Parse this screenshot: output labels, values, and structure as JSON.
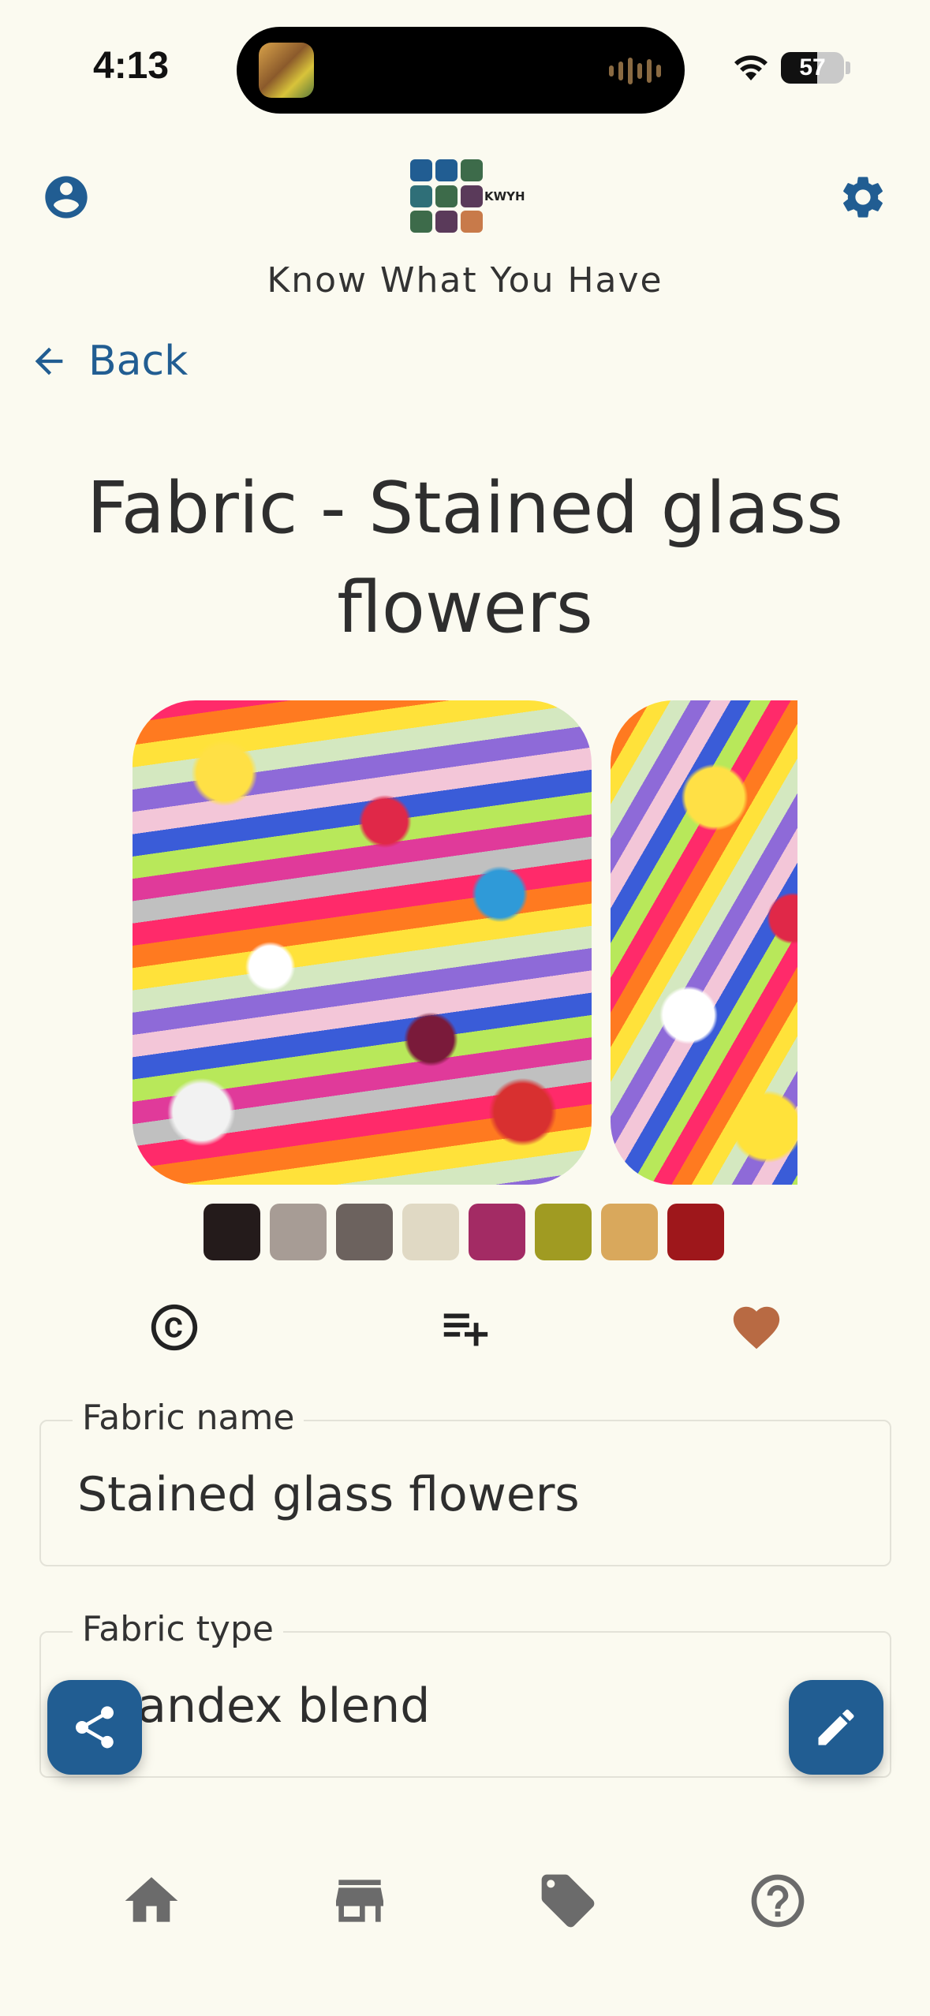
{
  "status_bar": {
    "time": "4:13",
    "battery": "57"
  },
  "header": {
    "logo_text": "KWYH",
    "app_title": "Know What You Have"
  },
  "nav": {
    "back_label": "Back"
  },
  "page": {
    "title": "Fabric - Stained glass flowers"
  },
  "swatches": [
    "#241b1b",
    "#a79c95",
    "#6c625e",
    "#e0d9c4",
    "#a32b64",
    "#a09b22",
    "#d9a85c",
    "#9e171b"
  ],
  "actions": {
    "copyright_icon": "copyright-icon",
    "add_to_list_icon": "playlist-add-icon",
    "favorite_icon": "heart-icon",
    "favorite_color": "#b86a43"
  },
  "fields": {
    "fabric_name": {
      "label": "Fabric name",
      "value": "Stained glass flowers"
    },
    "fabric_type": {
      "label": "Fabric type",
      "value": "Spandex blend"
    }
  },
  "colors": {
    "primary": "#215d92",
    "background": "#fbfaf0"
  },
  "bottom_nav": [
    "home-icon",
    "store-icon",
    "tag-icon",
    "help-icon"
  ]
}
